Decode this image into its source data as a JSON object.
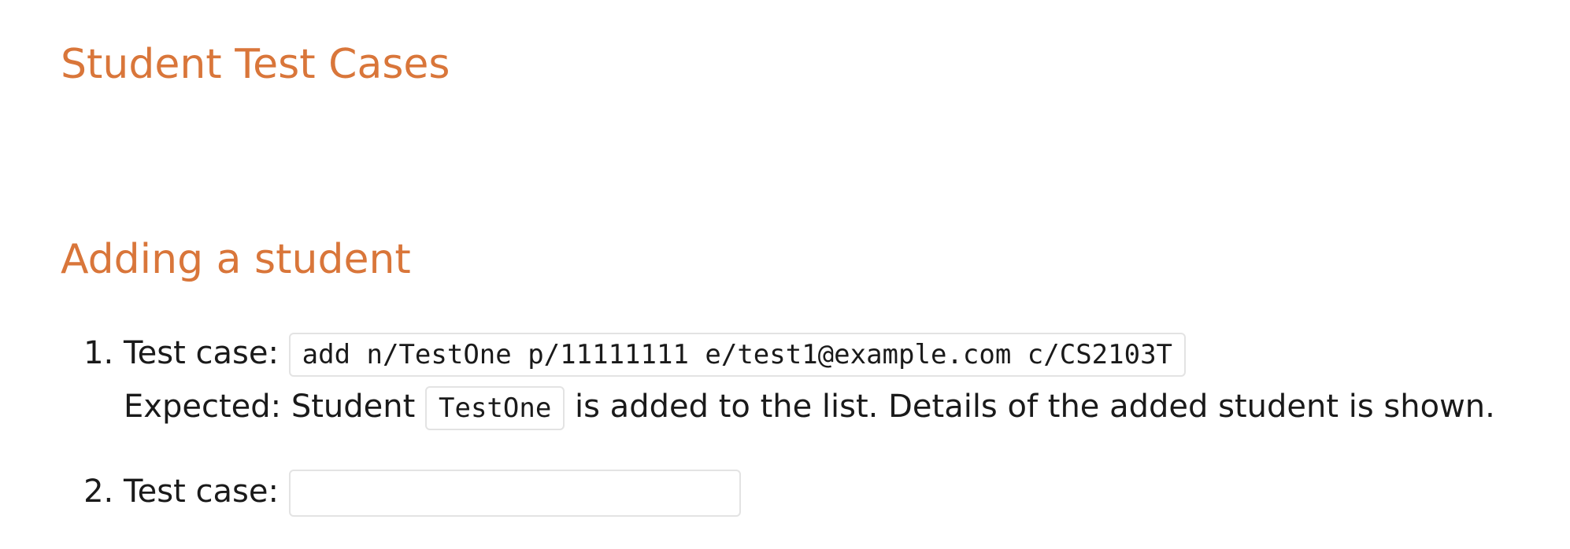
{
  "page": {
    "title": "Student Test Cases"
  },
  "sections": [
    {
      "heading": "Adding a student",
      "items": [
        {
          "case_label": "Test case:",
          "command": "add n/TestOne p/11111111 e/test1@example.com c/CS2103T",
          "expected_prefix": "Expected: Student",
          "expected_code": "TestOne",
          "expected_suffix": "is added to the list. Details of the added student is shown."
        },
        {
          "case_label": "Test case:",
          "command": ""
        }
      ]
    }
  ],
  "colors": {
    "heading": "#d9763a",
    "text": "#1a1a1a",
    "code_border": "#e3e3e3"
  }
}
